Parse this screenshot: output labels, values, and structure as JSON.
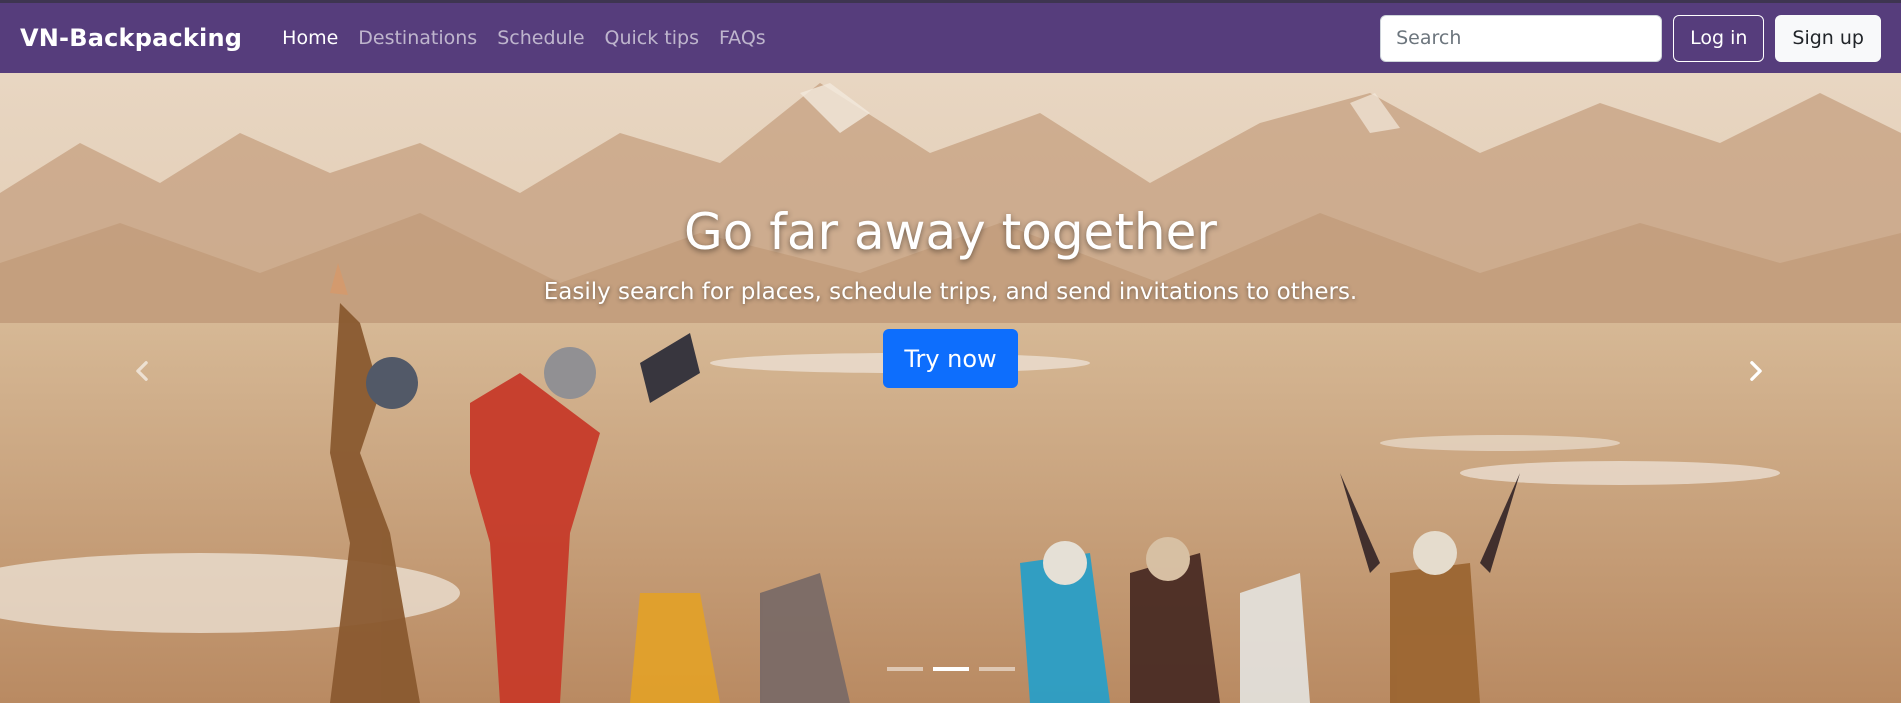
{
  "navbar": {
    "brand": "VN-Backpacking",
    "links": [
      {
        "label": "Home",
        "active": true
      },
      {
        "label": "Destinations",
        "active": false
      },
      {
        "label": "Schedule",
        "active": false
      },
      {
        "label": "Quick tips",
        "active": false
      },
      {
        "label": "FAQs",
        "active": false
      }
    ],
    "search_placeholder": "Search",
    "login_label": "Log in",
    "signup_label": "Sign up",
    "background_color": "#563d7c"
  },
  "hero": {
    "title": "Go far away together",
    "subtitle": "Easily search for places, schedule trips, and send invitations to others.",
    "cta_label": "Try now",
    "cta_color": "#0d6efd",
    "prev_icon": "chevron-left-icon",
    "next_icon": "chevron-right-icon",
    "slide_count": 3,
    "active_slide": 1
  }
}
